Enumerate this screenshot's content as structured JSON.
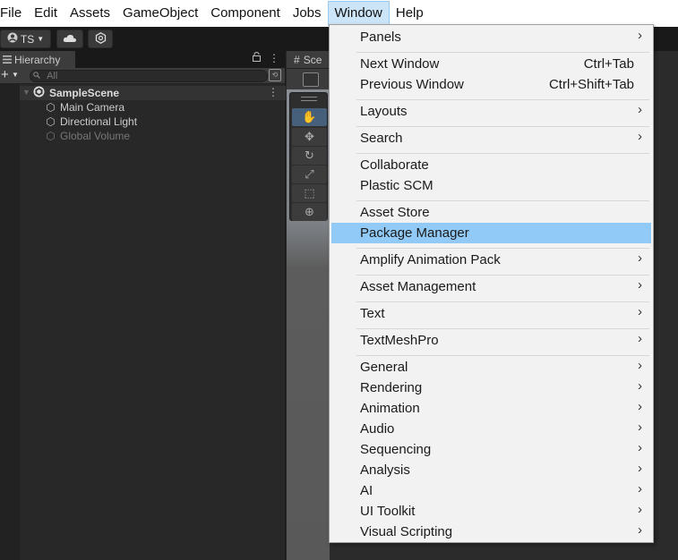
{
  "menubar": {
    "items": [
      {
        "label": "File"
      },
      {
        "label": "Edit"
      },
      {
        "label": "Assets"
      },
      {
        "label": "GameObject"
      },
      {
        "label": "Component"
      },
      {
        "label": "Jobs"
      },
      {
        "label": "Window"
      },
      {
        "label": "Help"
      }
    ],
    "active_item": "Window"
  },
  "toolbar": {
    "account_label": "TS",
    "account_icon": "user-circle-icon",
    "cloud_icon": "cloud-icon",
    "collab_icon": "hexagon-icon"
  },
  "hierarchy": {
    "tab_label": "Hierarchy",
    "search_placeholder": "All",
    "scene": {
      "name": "SampleScene"
    },
    "objects": [
      {
        "name": "Main Camera",
        "enabled": true
      },
      {
        "name": "Directional Light",
        "enabled": true
      },
      {
        "name": "Global Volume",
        "enabled": false
      }
    ]
  },
  "scene_view": {
    "tab_label": "Sce"
  },
  "window_menu": {
    "highlighted": "Package Manager",
    "items": [
      {
        "label": "Panels",
        "submenu": true
      },
      {
        "label": "Next Window",
        "shortcut": "Ctrl+Tab"
      },
      {
        "label": "Previous Window",
        "shortcut": "Ctrl+Shift+Tab"
      },
      {
        "label": "Layouts",
        "submenu": true
      },
      {
        "label": "Search",
        "submenu": true
      },
      {
        "label": "Collaborate"
      },
      {
        "label": "Plastic SCM"
      },
      {
        "label": "Asset Store"
      },
      {
        "label": "Package Manager"
      },
      {
        "label": "Amplify Animation Pack",
        "submenu": true
      },
      {
        "label": "Asset Management",
        "submenu": true
      },
      {
        "label": "Text",
        "submenu": true
      },
      {
        "label": "TextMeshPro",
        "submenu": true
      },
      {
        "label": "General",
        "submenu": true
      },
      {
        "label": "Rendering",
        "submenu": true
      },
      {
        "label": "Animation",
        "submenu": true
      },
      {
        "label": "Audio",
        "submenu": true
      },
      {
        "label": "Sequencing",
        "submenu": true
      },
      {
        "label": "Analysis",
        "submenu": true
      },
      {
        "label": "AI",
        "submenu": true
      },
      {
        "label": "UI Toolkit",
        "submenu": true
      },
      {
        "label": "Visual Scripting",
        "submenu": true
      }
    ],
    "submenu_glyph": "›"
  },
  "colors": {
    "menu_highlight": "#91c9f7",
    "active_menubar_item": "#cce4f7",
    "panel_bg": "#282828",
    "selected_tool": "#46607c"
  }
}
